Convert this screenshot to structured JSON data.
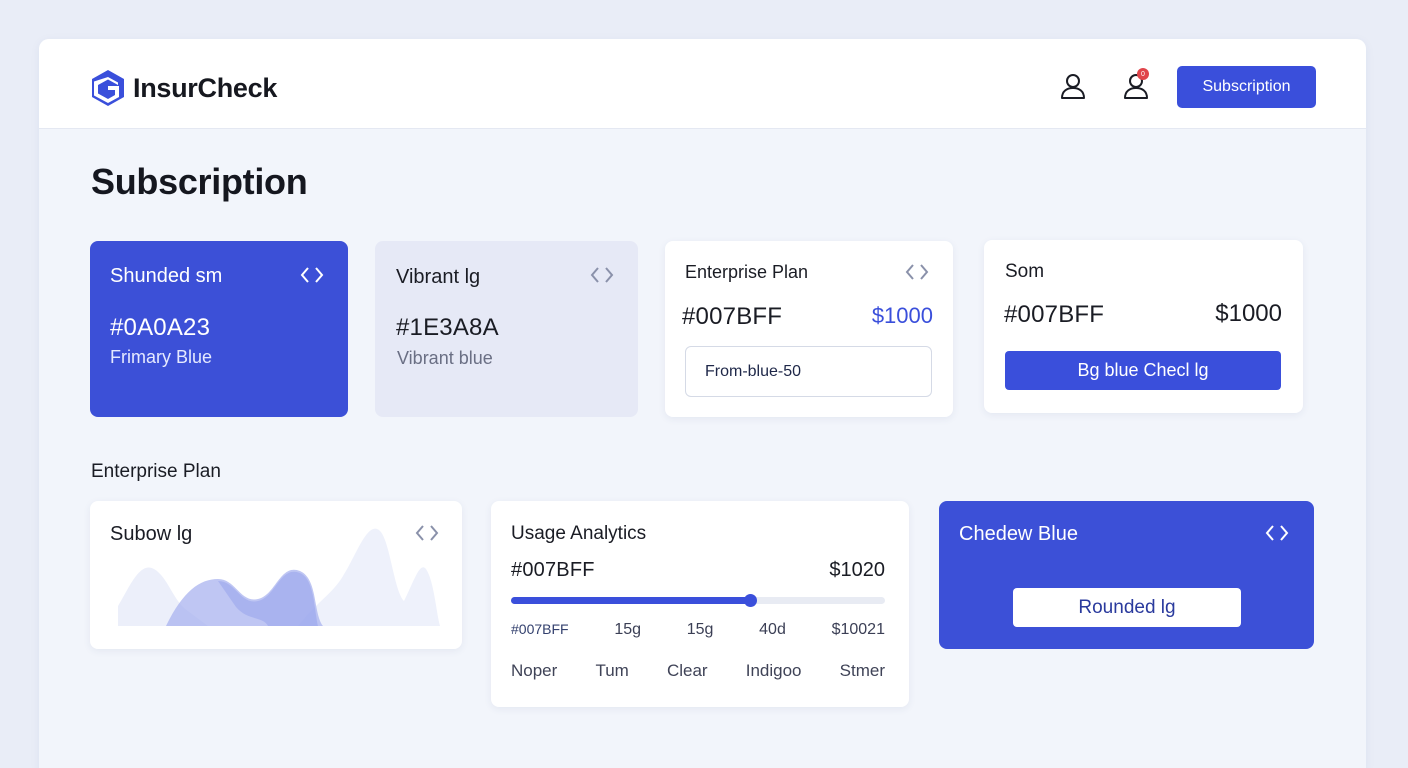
{
  "brand": {
    "name": "InsurCheck"
  },
  "header": {
    "profile_icon": "user-icon",
    "notifications_icon": "user-notification-icon",
    "notification_badge": "0",
    "subscription_button": "Subscription"
  },
  "page": {
    "title": "Subscription"
  },
  "colors": {
    "accent": "#3a4fdb",
    "lavender": "#e6e9f6",
    "badge": "#e0454b"
  },
  "cards_top": [
    {
      "title": "Shunded sm",
      "hex": "#0A0A23",
      "label": "Frimary Blue",
      "icon": "code-brackets-icon"
    },
    {
      "title": "Vibrant lg",
      "hex": "#1E3A8A",
      "label": "Vibrant blue",
      "icon": "code-brackets-icon"
    },
    {
      "title": "Enterprise Plan",
      "hex": "#007BFF",
      "price": "$1000",
      "button": "From-blue-50",
      "icon": "code-brackets-icon"
    },
    {
      "title": "Som",
      "hex": "#007BFF",
      "price": "$1000",
      "button": "Bg blue Checl lg"
    }
  ],
  "section_label": "Enterprise Plan",
  "cards_bottom": {
    "chart_card": {
      "title": "Subow lg",
      "icon": "code-brackets-icon"
    },
    "analytics": {
      "title": "Usage Analytics",
      "hex": "#007BFF",
      "price": "$1020",
      "progress": 0.64,
      "row1": [
        "#007BFF",
        "15g",
        "15g",
        "40d",
        "$10021"
      ],
      "row2": [
        "Noper",
        "Tum",
        "Clear",
        "Indigoo",
        "Stmer"
      ]
    },
    "blue_card": {
      "title": "Chedew Blue",
      "button": "Rounded lg",
      "icon": "code-brackets-icon"
    }
  }
}
